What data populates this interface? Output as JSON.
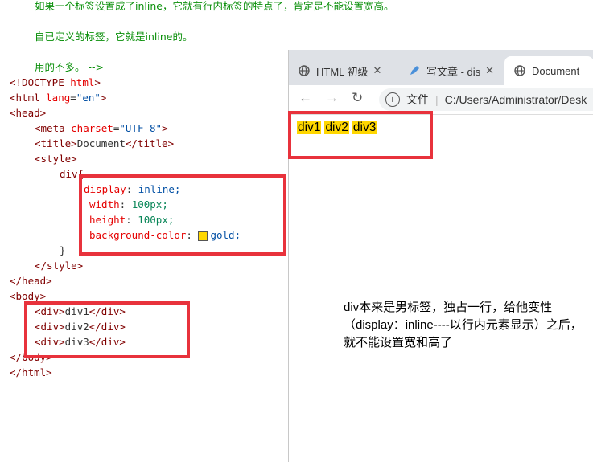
{
  "editor": {
    "comment_line1": "如果一个标签设置成了inline，它就有行内标签的特点了，肯定是不能设置宽高。",
    "comment_line2": "自已定义的标签，它就是inline的。",
    "comment_line3": "用的不多。 -->",
    "doctype_open": "<!DOCTYPE ",
    "doctype_name": "html",
    "doctype_close": ">",
    "html_open": "<html ",
    "lang_attr": "lang",
    "lang_eq": "=",
    "lang_val": "\"en\"",
    "gt": ">",
    "head_open": "<head>",
    "meta_open": "<meta ",
    "charset_attr": "charset",
    "charset_val": "\"UTF-8\"",
    "title_open": "<title>",
    "title_text": "Document",
    "title_close": "</title>",
    "style_open": "<style>",
    "selector": "div{",
    "prop1": "display",
    "val1": "inline;",
    "prop2": "width",
    "val2": "100px;",
    "prop3": "height",
    "val3": "100px;",
    "prop4": "background-color",
    "val4": "gold;",
    "colon": ": ",
    "rule_close": "}",
    "style_close": "</style>",
    "head_close": "</head>",
    "body_open": "<body>",
    "div1_open": "<div>",
    "div1_text": "div1",
    "div1_close": "</div>",
    "div2_text": "div2",
    "div3_text": "div3",
    "body_close": "</body>",
    "html_close": "</html>"
  },
  "browser": {
    "tabs": [
      {
        "label": "HTML 初级",
        "icon": "globe-icon"
      },
      {
        "label": "写文章 - dis",
        "icon": "pen-icon"
      },
      {
        "label": "Document",
        "icon": "globe-icon"
      }
    ],
    "file_label": "文件",
    "url": "C:/Users/Administrator/Desk",
    "output": [
      "div1",
      "div2",
      "div3"
    ]
  },
  "annotation": "div本来是男标签，独占一行，给他变性（display：inline----以行内元素显示）之后，就不能设置宽和高了",
  "colors": {
    "highlight": "#e8323c",
    "gold": "#ffd700"
  }
}
